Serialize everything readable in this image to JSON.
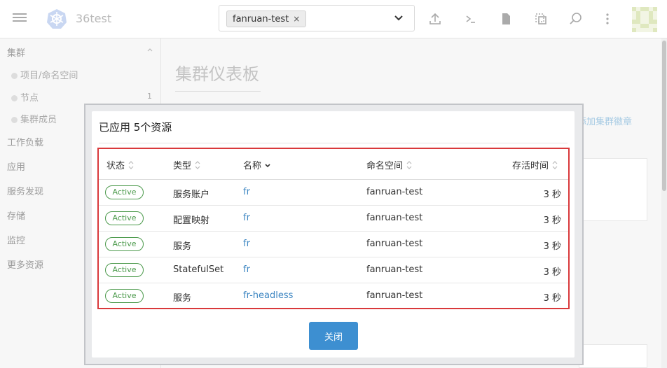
{
  "app": {
    "title": "36test"
  },
  "namespace": {
    "selected": "fanruan-test",
    "remove_icon": "×"
  },
  "toolbar": {
    "icons": [
      "upload-icon",
      "terminal-icon",
      "file-icon",
      "copy-icon",
      "search-icon",
      "more-vertical-icon"
    ]
  },
  "sidebar": {
    "cluster": "集群",
    "projects": "项目/命名空间",
    "nodes": "节点",
    "nodes_count": "1",
    "members": "集群成员",
    "workloads": "工作负载",
    "apps": "应用",
    "service_discovery": "服务发现",
    "storage": "存储",
    "monitoring": "监控",
    "more": "更多资源"
  },
  "page": {
    "title": "集群仪表板",
    "add_badge_link": "添加集群徽章"
  },
  "modal": {
    "title": "已应用 5个资源",
    "columns": {
      "status": "状态",
      "type": "类型",
      "name": "名称",
      "namespace": "命名空间",
      "age": "存活时间"
    },
    "rows": [
      {
        "status": "Active",
        "type": "服务账户",
        "name": "fr",
        "namespace": "fanruan-test",
        "age": "3 秒"
      },
      {
        "status": "Active",
        "type": "配置映射",
        "name": "fr",
        "namespace": "fanruan-test",
        "age": "3 秒"
      },
      {
        "status": "Active",
        "type": "服务",
        "name": "fr",
        "namespace": "fanruan-test",
        "age": "3 秒"
      },
      {
        "status": "Active",
        "type": "StatefulSet",
        "name": "fr",
        "namespace": "fanruan-test",
        "age": "3 秒"
      },
      {
        "status": "Active",
        "type": "服务",
        "name": "fr-headless",
        "namespace": "fanruan-test",
        "age": "3 秒"
      }
    ],
    "close_label": "关闭"
  },
  "colors": {
    "accent": "#3d8fd1",
    "link": "#3d86c2",
    "active_badge": "#4c9a4c",
    "highlight_border": "#d9393b"
  }
}
